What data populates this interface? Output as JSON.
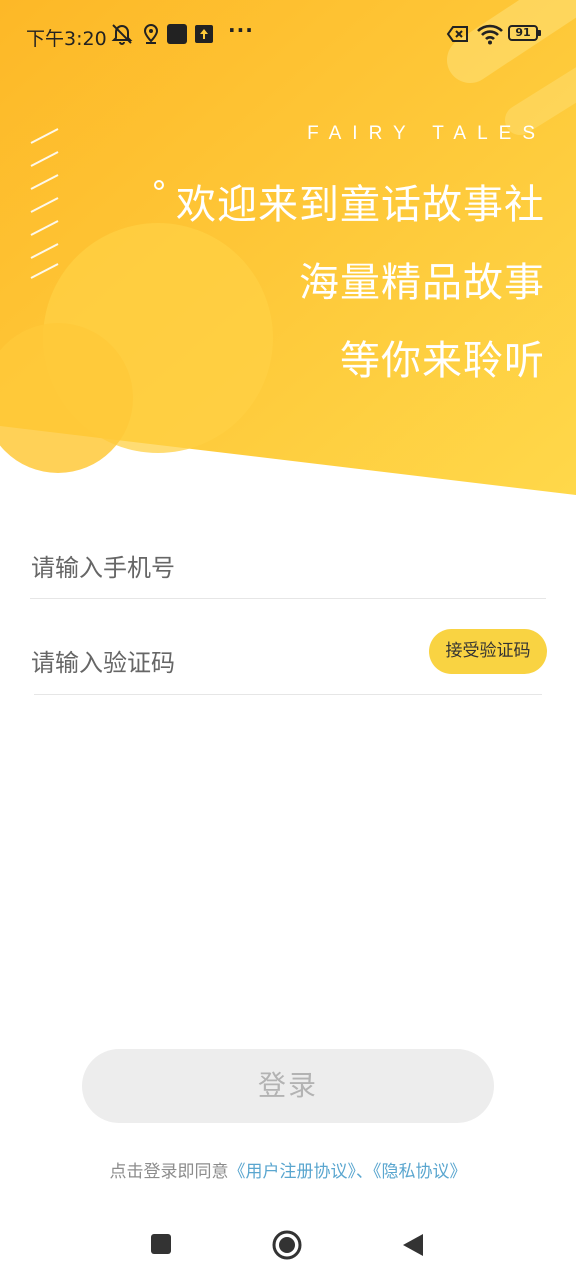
{
  "status_bar": {
    "time": "下午3:20",
    "battery": "91",
    "more": "···",
    "icons": [
      "muted-bell-icon",
      "location-pin-icon",
      "app-square-icon",
      "upload-icon",
      "sim-x-icon",
      "wifi-icon",
      "battery-icon"
    ]
  },
  "hero": {
    "tagline": "FAIRY TALES",
    "line1": "欢迎来到童话故事社",
    "line2": "海量精品故事",
    "line3": "等你来聆听"
  },
  "form": {
    "phone_placeholder": "请输入手机号",
    "code_placeholder": "请输入验证码",
    "get_code_label": "接受验证码"
  },
  "login": {
    "label": "登录"
  },
  "agreement": {
    "prefix": "点击登录即同意",
    "user_agreement": "《用户注册协议》",
    "separator": "、",
    "privacy": "《隐私协议》"
  },
  "nav": {
    "icons": [
      "recents-icon",
      "home-icon",
      "back-icon"
    ]
  },
  "colors": {
    "accent_yellow": "#f9d342",
    "hero_gradient_start": "#fdb827",
    "hero_gradient_end": "#ffd84a",
    "link": "#5aa6cf",
    "login_bg": "#ededed"
  }
}
